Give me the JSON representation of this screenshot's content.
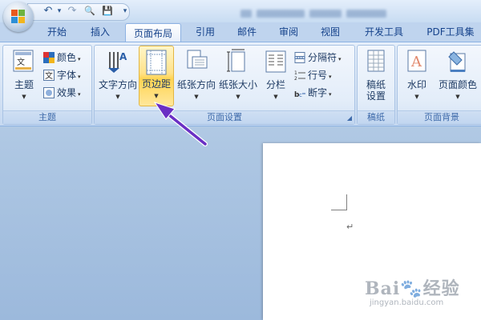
{
  "titlebar": {
    "quick_access": [
      {
        "icon": "undo-icon",
        "glyph": "↶"
      },
      {
        "icon": "undo-dropdown-icon",
        "glyph": "▾"
      },
      {
        "icon": "redo-icon",
        "glyph": "↷"
      },
      {
        "icon": "print-preview-icon",
        "glyph": "🔍"
      },
      {
        "icon": "save-icon",
        "glyph": "💾"
      },
      {
        "icon": "customize-qat-icon",
        "glyph": "▾"
      }
    ]
  },
  "tabs": [
    "开始",
    "插入",
    "页面布局",
    "引用",
    "邮件",
    "审阅",
    "视图",
    "开发工具",
    "PDF工具集"
  ],
  "active_tab": "页面布局",
  "groups": {
    "theme": {
      "label": "主题",
      "theme_button": "主题",
      "colors": "颜色",
      "fonts": "字体",
      "effects": "效果"
    },
    "page_setup": {
      "label": "页面设置",
      "text_direction": "文字方向",
      "margins": "页边距",
      "orientation": "纸张方向",
      "size": "纸张大小",
      "columns": "分栏",
      "breaks": "分隔符",
      "line_numbers": "行号",
      "hyphenation": "断字"
    },
    "draft": {
      "label": "稿纸",
      "button_line1": "稿纸",
      "button_line2": "设置"
    },
    "page_background": {
      "label": "页面背景",
      "watermark": "水印",
      "page_color": "页面颜色"
    }
  },
  "document": {
    "paragraph_mark": "↵"
  },
  "watermark": {
    "brand": "Bai",
    "brand_suffix": "经验",
    "url": "jingyan.baidu.com"
  },
  "colors": {
    "accent": "#15428b",
    "highlight": "#ffd452",
    "arrow": "#6a2fc4"
  }
}
